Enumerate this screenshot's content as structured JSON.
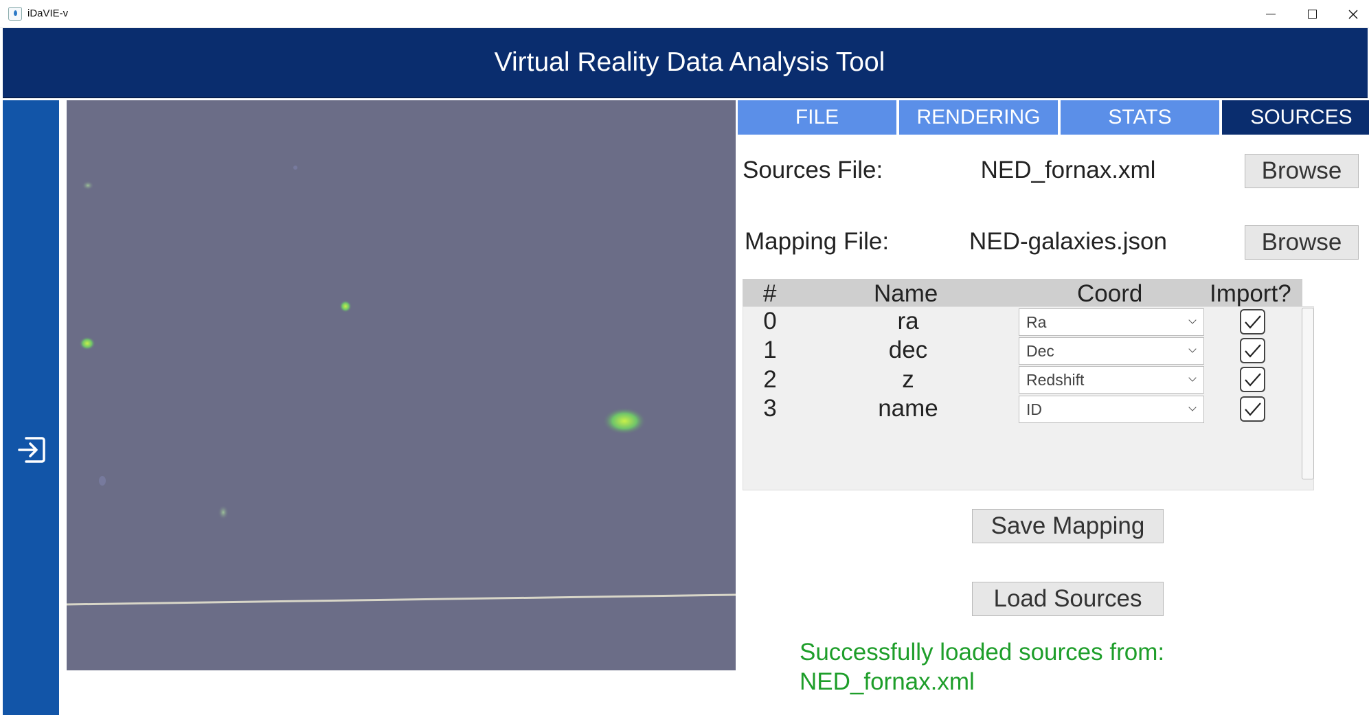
{
  "window": {
    "title": "iDaVIE-v"
  },
  "header": {
    "title": "Virtual Reality Data Analysis Tool"
  },
  "sidebar": {
    "icon": "exit-icon"
  },
  "tabs": [
    {
      "label": "FILE",
      "active": false
    },
    {
      "label": "RENDERING",
      "active": false
    },
    {
      "label": "STATS",
      "active": false
    },
    {
      "label": "SOURCES",
      "active": true
    }
  ],
  "sources": {
    "sources_file_label": "Sources File:",
    "sources_file_value": "NED_fornax.xml",
    "mapping_file_label": "Mapping File:",
    "mapping_file_value": "NED-galaxies.json",
    "browse_label": "Browse",
    "table": {
      "headers": {
        "index": "#",
        "name": "Name",
        "coord": "Coord",
        "import": "Import?"
      },
      "rows": [
        {
          "index": "0",
          "name": "ra",
          "coord": "Ra",
          "import": true
        },
        {
          "index": "1",
          "name": "dec",
          "coord": "Dec",
          "import": true
        },
        {
          "index": "2",
          "name": "z",
          "coord": "Redshift",
          "import": true
        },
        {
          "index": "3",
          "name": "name",
          "coord": "ID",
          "import": true
        }
      ]
    },
    "save_mapping_label": "Save Mapping",
    "load_sources_label": "Load Sources",
    "status_line1": "Successfully loaded sources from:",
    "status_line2": "NED_fornax.xml"
  },
  "colors": {
    "header": "#0a2d6e",
    "sidebar": "#1255a8",
    "tab": "#5b8fe8",
    "tab_active": "#0a2d6e",
    "success": "#1e9e2a"
  }
}
